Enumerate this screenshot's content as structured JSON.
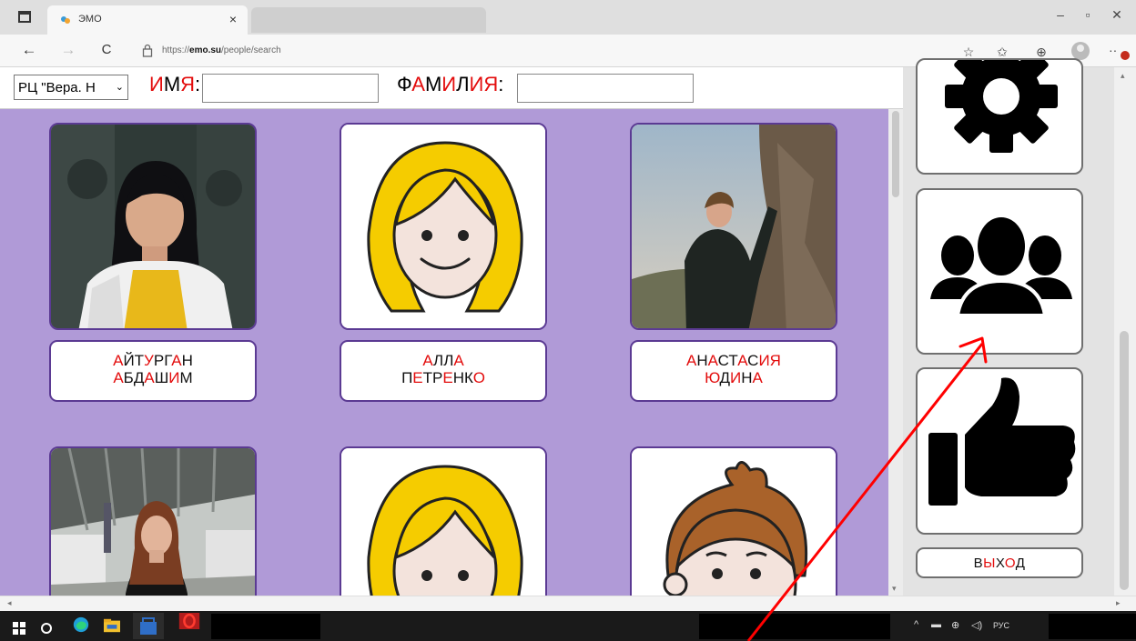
{
  "browser": {
    "tab_title": "ЭМО",
    "tab_close": "×",
    "url_prefix": "https://",
    "url_host": "emo.su",
    "url_path": "/people/search",
    "win_minimize": "–",
    "win_maximize": "▫",
    "win_close": "✕",
    "nav_back": "←",
    "nav_forward": "→",
    "nav_reload": "C"
  },
  "filters": {
    "org_select_value": "РЦ \"Вера. Н",
    "first_name_label": [
      {
        "t": "И",
        "red": true
      },
      {
        "t": "М",
        "red": false
      },
      {
        "t": "Я",
        "red": true
      },
      {
        "t": ":",
        "red": false
      }
    ],
    "last_name_label": [
      {
        "t": "Ф",
        "red": false
      },
      {
        "t": "А",
        "red": true
      },
      {
        "t": "М",
        "red": false
      },
      {
        "t": "И",
        "red": true
      },
      {
        "t": "Л",
        "red": false
      },
      {
        "t": "И",
        "red": true
      },
      {
        "t": "Я",
        "red": true
      },
      {
        "t": ":",
        "red": false
      }
    ],
    "first_name_value": "",
    "last_name_value": ""
  },
  "people": [
    {
      "image": "photo-girl-black-hair",
      "name_lines": [
        [
          {
            "t": "А",
            "red": true
          },
          {
            "t": "Й",
            "red": false
          },
          {
            "t": "Т",
            "red": false
          },
          {
            "t": "У",
            "red": true
          },
          {
            "t": "Р",
            "red": false
          },
          {
            "t": "Г",
            "red": false
          },
          {
            "t": "А",
            "red": true
          },
          {
            "t": "Н",
            "red": false
          }
        ],
        [
          {
            "t": "А",
            "red": true
          },
          {
            "t": "Б",
            "red": false
          },
          {
            "t": "Д",
            "red": false
          },
          {
            "t": "А",
            "red": true
          },
          {
            "t": "Ш",
            "red": false
          },
          {
            "t": "И",
            "red": true
          },
          {
            "t": "М",
            "red": false
          }
        ]
      ]
    },
    {
      "image": "avatar-blonde-girl",
      "name_lines": [
        [
          {
            "t": "А",
            "red": true
          },
          {
            "t": "Л",
            "red": false
          },
          {
            "t": "Л",
            "red": false
          },
          {
            "t": "А",
            "red": true
          }
        ],
        [
          {
            "t": "П",
            "red": false
          },
          {
            "t": "Е",
            "red": true
          },
          {
            "t": "Т",
            "red": false
          },
          {
            "t": "Р",
            "red": false
          },
          {
            "t": "Е",
            "red": true
          },
          {
            "t": "Н",
            "red": false
          },
          {
            "t": "К",
            "red": false
          },
          {
            "t": "О",
            "red": true
          }
        ]
      ]
    },
    {
      "image": "photo-woman-climbing",
      "name_lines": [
        [
          {
            "t": "А",
            "red": true
          },
          {
            "t": "Н",
            "red": false
          },
          {
            "t": "А",
            "red": true
          },
          {
            "t": "С",
            "red": false
          },
          {
            "t": "Т",
            "red": false
          },
          {
            "t": "А",
            "red": true
          },
          {
            "t": "С",
            "red": false
          },
          {
            "t": "И",
            "red": true
          },
          {
            "t": "Я",
            "red": true
          }
        ],
        [
          {
            "t": "Ю",
            "red": true
          },
          {
            "t": "Д",
            "red": false
          },
          {
            "t": "И",
            "red": true
          },
          {
            "t": "Н",
            "red": false
          },
          {
            "t": "А",
            "red": true
          }
        ]
      ]
    },
    {
      "image": "photo-girl-street",
      "name_lines": []
    },
    {
      "image": "avatar-blonde-girl",
      "name_lines": []
    },
    {
      "image": "avatar-boy-brown-hair",
      "name_lines": []
    }
  ],
  "sidebar": {
    "buttons": [
      {
        "icon": "gear-icon"
      },
      {
        "icon": "people-group-icon"
      },
      {
        "icon": "thumbs-up-icon"
      }
    ],
    "exit_label": [
      {
        "t": "В",
        "red": false
      },
      {
        "t": "Ы",
        "red": true
      },
      {
        "t": "Х",
        "red": false
      },
      {
        "t": "О",
        "red": true
      },
      {
        "t": "Д",
        "red": false
      }
    ]
  },
  "taskbar": {
    "tray_lang": "РУС",
    "tray_caret": "^"
  },
  "colors": {
    "gallery_bg": "#b09ad7",
    "card_border": "#5b3a93",
    "vowel_red": "#e30d0d",
    "annotation_arrow": "#ff0000"
  }
}
